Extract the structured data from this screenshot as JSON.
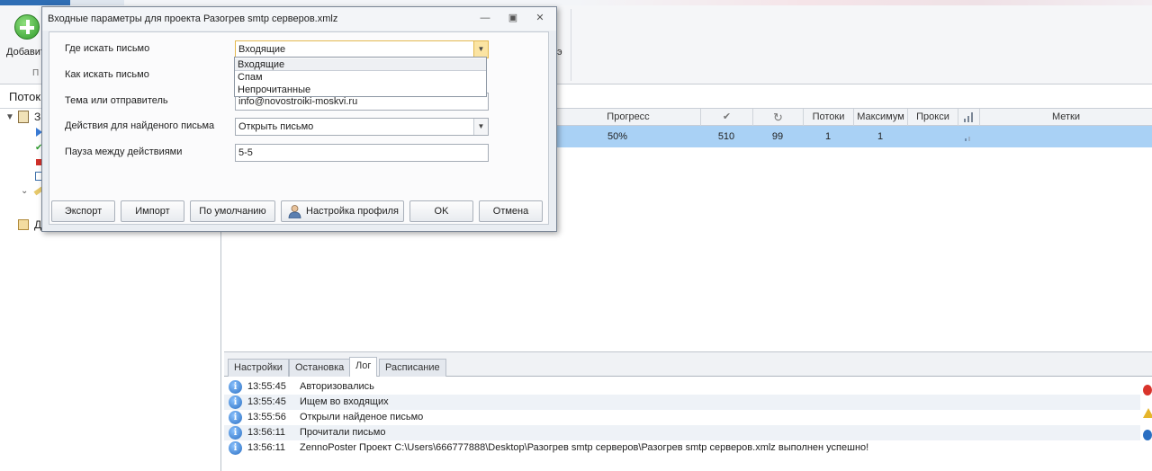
{
  "ribbon": {
    "add_label": "Добавит",
    "group_label": "П",
    "fragment": "э"
  },
  "left_panel": {
    "title": "Поток",
    "tree_label_1": "З",
    "tree_label_2": "Д"
  },
  "grid": {
    "headers": {
      "progress": "Прогресс",
      "done_icon": "✔",
      "retry_icon": "↻",
      "threads": "Потоки",
      "max": "Максимум",
      "proxy": "Прокси",
      "signal_icon": "signal-icon",
      "tags": "Метки"
    },
    "row": {
      "progress_text": "50%",
      "progress_value": 0.5,
      "done": "510",
      "retry": "99",
      "threads": "1",
      "max": "1"
    }
  },
  "bottom_tabs": [
    {
      "label": "Настройки"
    },
    {
      "label": "Остановка"
    },
    {
      "label": "Лог",
      "active": true
    },
    {
      "label": "Расписание"
    }
  ],
  "log": [
    {
      "time": "13:55:45",
      "message": "Авторизовались"
    },
    {
      "time": "13:55:45",
      "message": "Ищем во входящих"
    },
    {
      "time": "13:55:56",
      "message": "Открыли найденое письмо"
    },
    {
      "time": "13:56:11",
      "message": "Прочитали письмо"
    },
    {
      "time": "13:56:11",
      "message": "ZennoPoster Проект C:\\Users\\666777888\\Desktop\\Разогрев smtp серверов\\Разогрев smtp серверов.xmlz выполнен успешно!"
    }
  ],
  "dialog": {
    "title": "Входные параметры для проекта Разогрев smtp серверов.xmlz",
    "fields": {
      "where": {
        "label": "Где искать письмо",
        "value": "Входящие"
      },
      "how": {
        "label": "Как искать письмо"
      },
      "subject": {
        "label": "Тема или отправитель",
        "value": "info@novostroiki-moskvi.ru"
      },
      "action": {
        "label": "Действия для найденого письма",
        "value": "Открыть письмо"
      },
      "pause": {
        "label": "Пауза между действиями",
        "value": "5-5"
      }
    },
    "dropdown_options": [
      "Входящие",
      "Спам",
      "Непрочитанные"
    ],
    "buttons": {
      "export": "Экспорт",
      "import": "Импорт",
      "default": "По умолчанию",
      "profile": "Настройка профиля",
      "ok": "OK",
      "cancel": "Отмена"
    }
  },
  "colors": {
    "accent": "#2f6eb5",
    "row_selected": "#a9d1f5",
    "progress_fill": "#3fae34",
    "dropdown_focus": "#e3b84f"
  }
}
